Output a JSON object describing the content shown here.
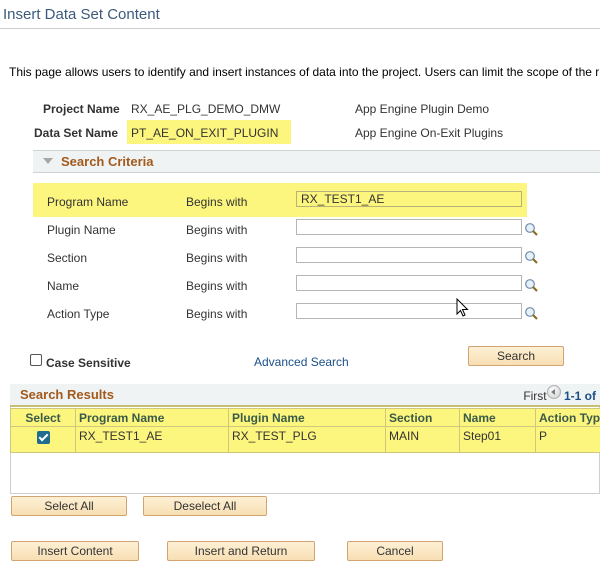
{
  "page": {
    "title": "Insert Data Set Content",
    "intro": "This page allows users to identify and insert instances of data into the project. Users can limit the scope of the r"
  },
  "header_fields": {
    "project_name_label": "Project Name",
    "project_name_value": "RX_AE_PLG_DEMO_DMW",
    "project_name_desc": "App Engine Plugin Demo",
    "data_set_name_label": "Data Set Name",
    "data_set_name_value": "PT_AE_ON_EXIT_PLUGIN",
    "data_set_name_desc": "App Engine On-Exit Plugins"
  },
  "search_criteria": {
    "title": "Search Criteria",
    "rows": [
      {
        "label": "Program Name",
        "operator": "Begins with",
        "value": "RX_TEST1_AE",
        "has_lookup": false
      },
      {
        "label": "Plugin Name",
        "operator": "Begins with",
        "value": "",
        "has_lookup": true
      },
      {
        "label": "Section",
        "operator": "Begins with",
        "value": "",
        "has_lookup": true
      },
      {
        "label": "Name",
        "operator": "Begins with",
        "value": "",
        "has_lookup": true
      },
      {
        "label": "Action Type",
        "operator": "Begins with",
        "value": "",
        "has_lookup": true
      }
    ],
    "case_sensitive_label": "Case Sensitive",
    "case_sensitive_checked": false,
    "advanced_search_label": "Advanced Search",
    "search_button": "Search"
  },
  "search_results": {
    "title": "Search Results",
    "pager_first": "First",
    "pager_range": "1-1 of",
    "columns": [
      "Select",
      "Program Name",
      "Plugin Name",
      "Section",
      "Name",
      "Action Type"
    ],
    "rows": [
      {
        "selected": true,
        "program_name": "RX_TEST1_AE",
        "plugin_name": "RX_TEST_PLG",
        "section": "MAIN",
        "name": "Step01",
        "action_type": "P"
      }
    ]
  },
  "buttons": {
    "select_all": "Select All",
    "deselect_all": "Deselect All",
    "insert_content": "Insert Content",
    "insert_and_return": "Insert and Return",
    "cancel": "Cancel"
  },
  "colors": {
    "highlight": "#fcf57e",
    "section_title": "#a25a1c",
    "link": "#1a4f86",
    "button_bg": "#f8dfb3"
  }
}
